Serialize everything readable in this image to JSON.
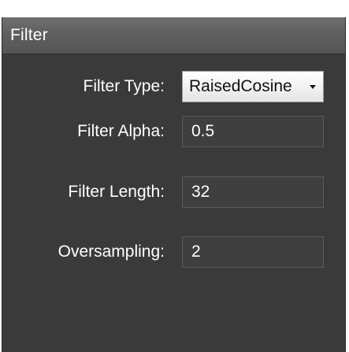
{
  "panel": {
    "title": "Filter"
  },
  "fields": {
    "filter_type": {
      "label": "Filter Type:",
      "value": "RaisedCosine"
    },
    "filter_alpha": {
      "label": "Filter Alpha:",
      "value": "0.5"
    },
    "filter_length": {
      "label": "Filter Length:",
      "value": "32"
    },
    "oversampling": {
      "label": "Oversampling:",
      "value": "2"
    }
  },
  "icons": {
    "dropdown": "chevron-down-icon"
  },
  "colors": {
    "panel_background": "#3a3a3a",
    "header_background": "#5f5f5f",
    "field_background": "#3f3f3f",
    "text": "#ffffff"
  }
}
